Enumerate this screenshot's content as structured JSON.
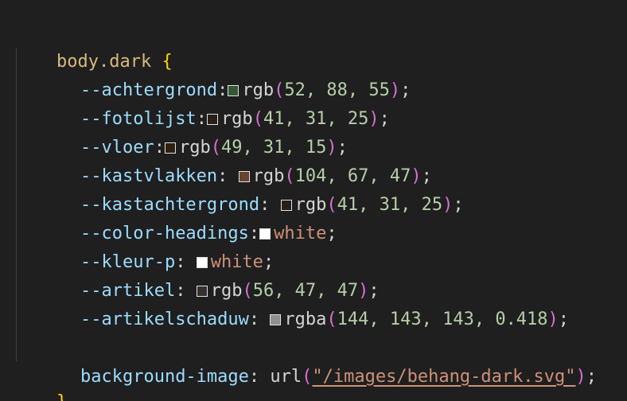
{
  "code": {
    "selector": "body.dark",
    "open_brace": "{",
    "close_brace": "}",
    "declarations": [
      {
        "property": "--achtergrond",
        "sep": ":",
        "value_fn": "rgb",
        "args": "52, 88, 55",
        "swatch": "#345837"
      },
      {
        "property": "--fotolijst",
        "sep": ":",
        "value_fn": "rgb",
        "args": "41, 31, 25",
        "swatch": "#291f19"
      },
      {
        "property": "--vloer",
        "sep": ":",
        "value_fn": "rgb",
        "args": "49, 31, 15",
        "swatch": "#311f0f"
      },
      {
        "property": "--kastvlakken",
        "sep": ": ",
        "value_fn": "rgb",
        "args": "104, 67, 47",
        "swatch": "#68432f"
      },
      {
        "property": "--kastachtergrond",
        "sep": ": ",
        "value_fn": "rgb",
        "args": "41, 31, 25",
        "swatch": "#291f19"
      },
      {
        "property": "--color-headings",
        "sep": ":",
        "value_kw": "white",
        "swatch": "#ffffff"
      },
      {
        "property": "--kleur-p",
        "sep": ": ",
        "value_kw": "white",
        "swatch": "#ffffff"
      },
      {
        "property": "--artikel",
        "sep": ": ",
        "value_fn": "rgb",
        "args": "56, 47, 47",
        "swatch": "#382f2f"
      },
      {
        "property": "--artikelschaduw",
        "sep": ": ",
        "value_fn": "rgba",
        "args": "144, 143, 143, 0.418",
        "swatch": "#908f8f"
      }
    ],
    "bg_property": "background-image",
    "bg_fn": "url",
    "bg_string": "\"/images/behang-dark.svg\""
  }
}
